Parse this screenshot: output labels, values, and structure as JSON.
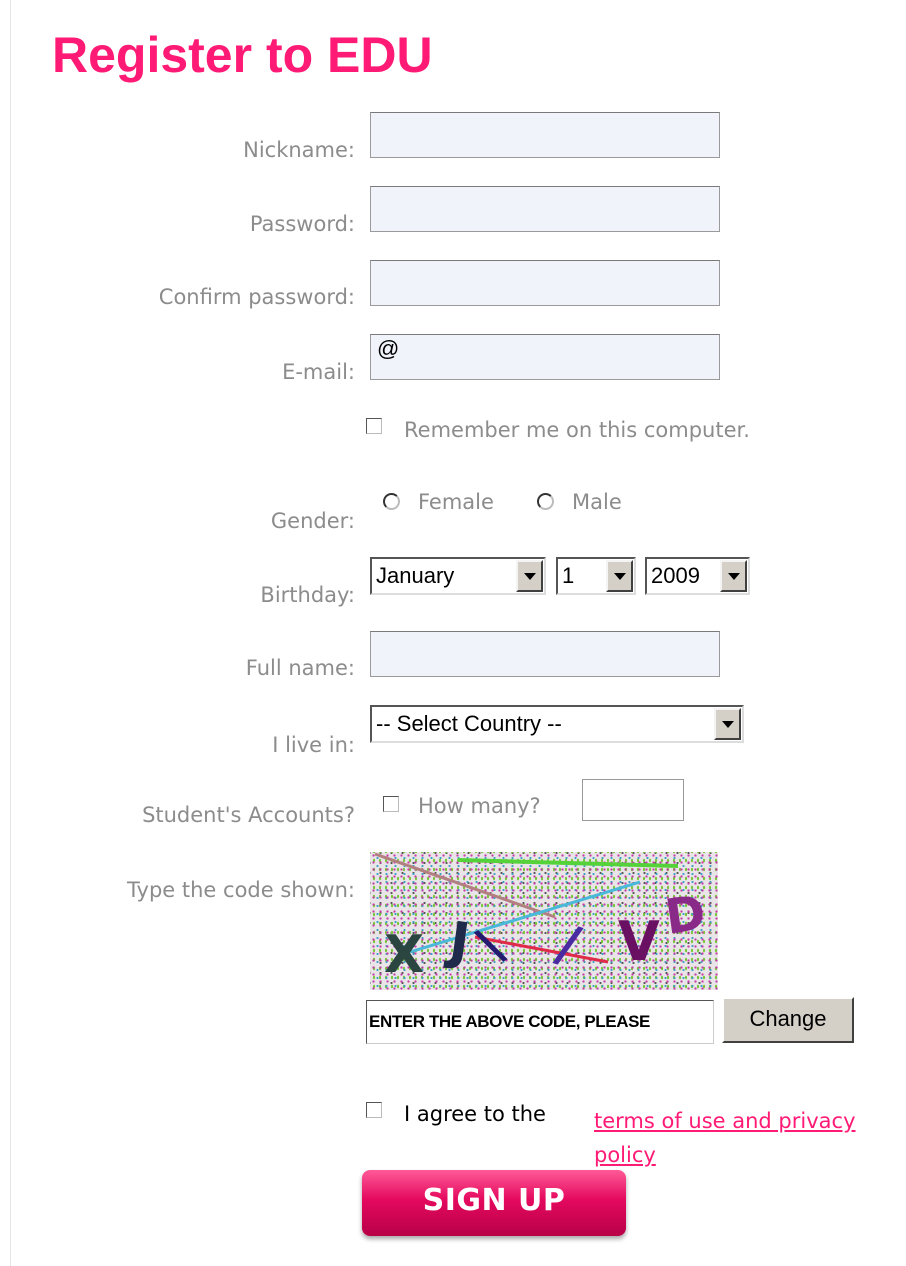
{
  "title": "Register to EDU",
  "fields": {
    "nickname": {
      "label": "Nickname:",
      "value": ""
    },
    "password": {
      "label": "Password:",
      "value": ""
    },
    "confirm_password": {
      "label": "Confirm password:",
      "value": ""
    },
    "email": {
      "label": "E-mail:",
      "value": "@"
    },
    "full_name": {
      "label": "Full name:",
      "value": ""
    }
  },
  "remember_me": {
    "label": "Remember me on this computer.",
    "checked": false
  },
  "gender": {
    "label": "Gender:",
    "options": [
      "Female",
      "Male"
    ],
    "selected": null
  },
  "birthday": {
    "label": "Birthday:",
    "month": "January",
    "day": "1",
    "year": "2009"
  },
  "country": {
    "label": "I live in:",
    "selected": "-- Select Country --"
  },
  "students": {
    "label": "Student's Accounts?",
    "how_many_label": "How many?",
    "value": ""
  },
  "captcha": {
    "label": "Type the code shown:",
    "characters": [
      "X",
      "J",
      "\\",
      "/",
      "V",
      "D"
    ],
    "entry_value": "ENTER THE ABOVE CODE, PLEASE",
    "change_label": "Change"
  },
  "terms": {
    "prefix": "I agree to the",
    "link": "terms of use and privacy policy",
    "checked": false
  },
  "signup_label": "SIGN UP",
  "colors": {
    "accent": "#ff1a75",
    "label_text": "#8c8c8c",
    "input_bg": "#f1f3fa"
  }
}
